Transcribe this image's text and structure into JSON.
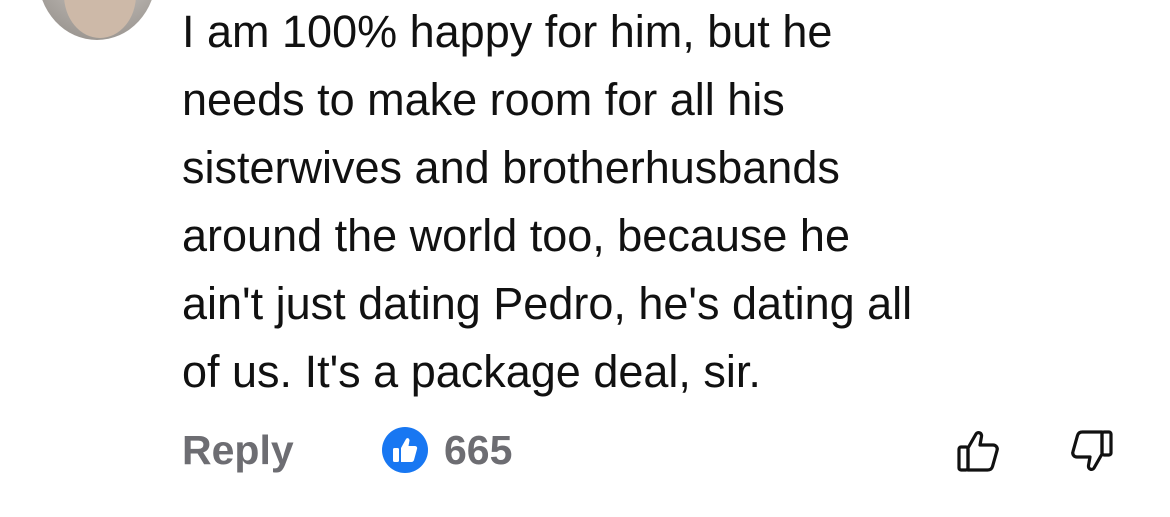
{
  "comment": {
    "lines": [
      "I am 100% happy for him, but he",
      "needs to make room for all his",
      "sisterwives and brotherhusbands",
      "around the world too, because he",
      "ain't just dating Pedro, he's dating all",
      "of us. It's a package deal, sir."
    ]
  },
  "actions": {
    "reply_label": "Reply",
    "reaction_count": "665",
    "reaction_icon": "like-icon"
  },
  "colors": {
    "text": "#111111",
    "muted": "#6d6d72",
    "like_blue": "#1877f2"
  }
}
